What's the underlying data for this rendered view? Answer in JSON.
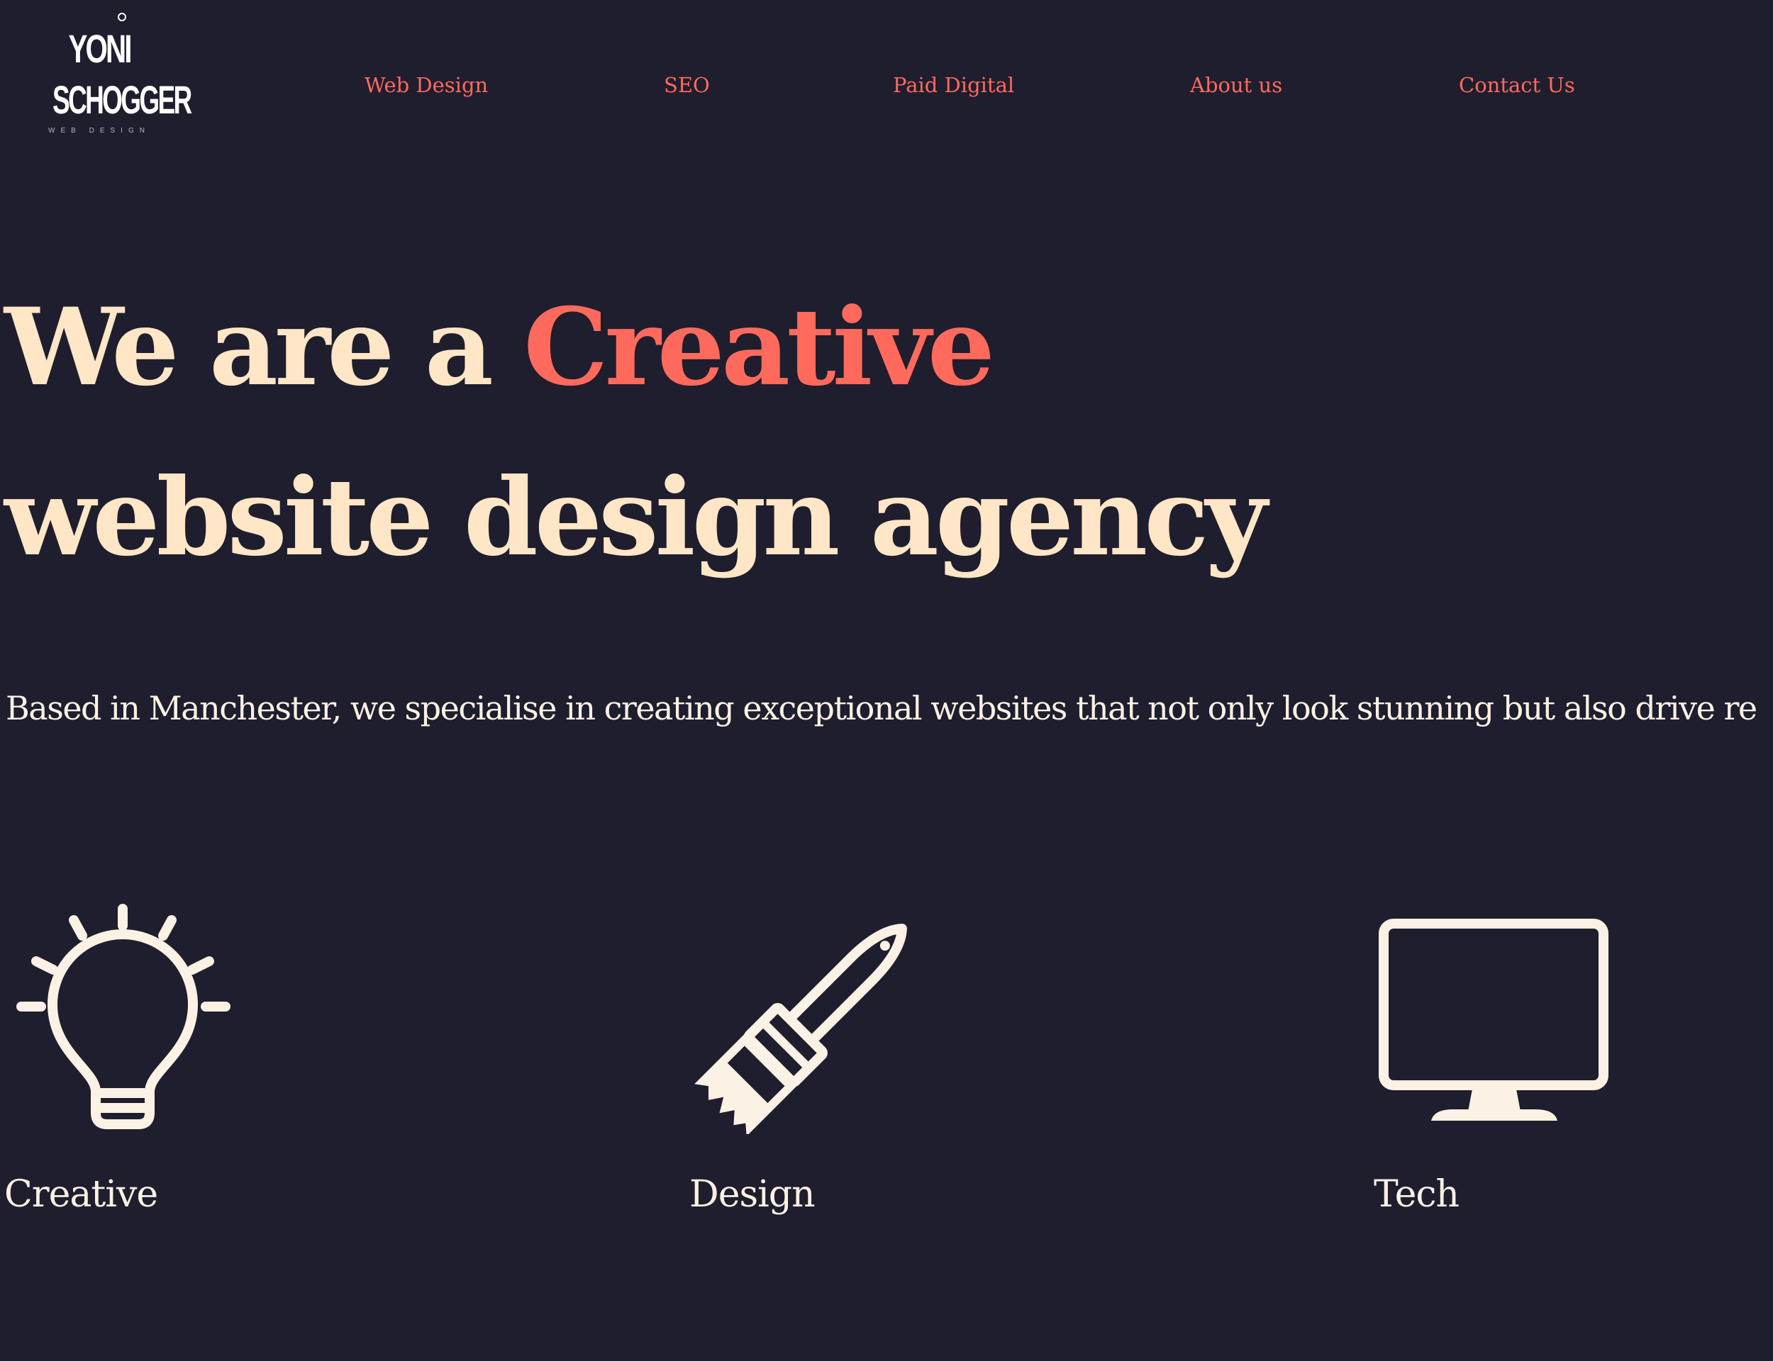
{
  "logo": {
    "line1": "YONI",
    "line2": "SCHOGGER",
    "line3": "WEB DESIGN"
  },
  "nav": {
    "items": [
      {
        "label": "Web Design"
      },
      {
        "label": "SEO"
      },
      {
        "label": "Paid Digital"
      },
      {
        "label": "About us"
      },
      {
        "label": "Contact Us"
      }
    ]
  },
  "hero": {
    "title_part1": "We are a ",
    "title_accent": "Creative",
    "title_line2": "website design agency",
    "description": "Based in Manchester, we specialise in creating exceptional websites that not only look stunning but also drive results business."
  },
  "features": [
    {
      "icon": "lightbulb-icon",
      "label": "Creative"
    },
    {
      "icon": "paintbrush-icon",
      "label": "Design"
    },
    {
      "icon": "monitor-icon",
      "label": "Tech"
    }
  ],
  "colors": {
    "background": "#1f1e2e",
    "accent": "#ff6a5c",
    "heading": "#ffe6c6",
    "text": "#fbf1e4"
  }
}
